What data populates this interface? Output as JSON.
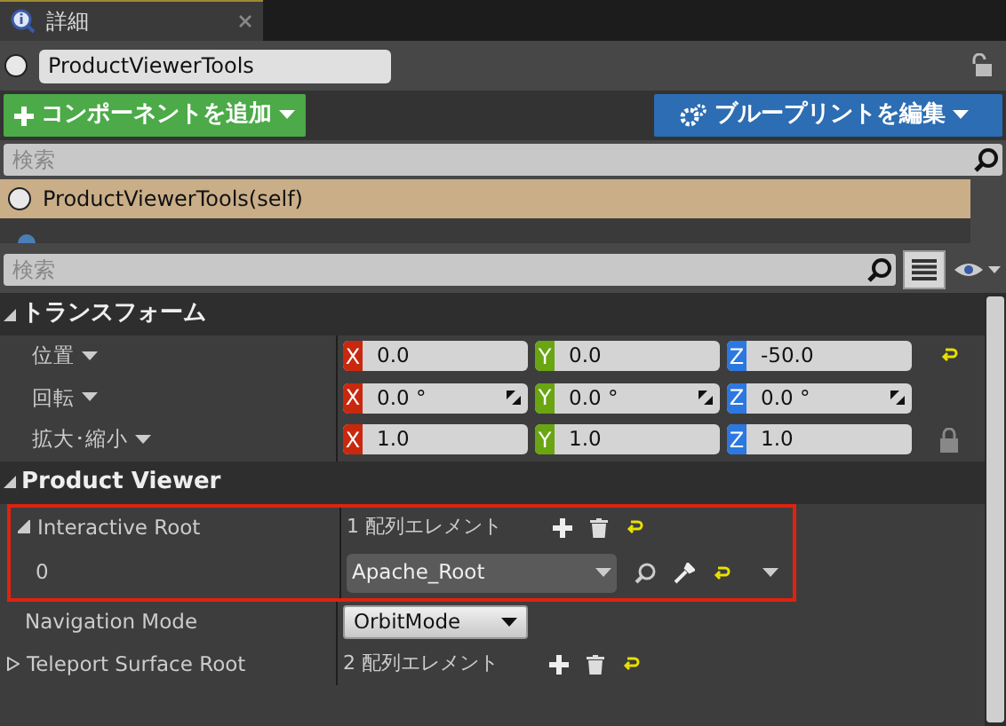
{
  "tab": {
    "title": "詳細"
  },
  "actor_name": "ProductViewerTools",
  "add_button": "コンポーネントを追加",
  "edit_button": "ブループリントを編集",
  "component_search": {
    "placeholder": "検索"
  },
  "components": [
    {
      "label": "ProductViewerTools(self)",
      "selected": true
    }
  ],
  "details_search": {
    "placeholder": "検索"
  },
  "sections": [
    {
      "title": "トランスフォーム",
      "expanded": true,
      "rows": [
        {
          "kind": "vector",
          "label": "位置",
          "reset": true,
          "locked": false,
          "spin": false,
          "fields": [
            {
              "axis": "X",
              "value": "0.0"
            },
            {
              "axis": "Y",
              "value": "0.0"
            },
            {
              "axis": "Z",
              "value": "-50.0"
            }
          ]
        },
        {
          "kind": "vector",
          "label": "回転",
          "reset": false,
          "locked": false,
          "spin": true,
          "fields": [
            {
              "axis": "X",
              "value": "0.0 °"
            },
            {
              "axis": "Y",
              "value": "0.0 °"
            },
            {
              "axis": "Z",
              "value": "0.0 °"
            }
          ]
        },
        {
          "kind": "vector",
          "label": "拡大･縮小",
          "reset": false,
          "locked": true,
          "spin": false,
          "fields": [
            {
              "axis": "X",
              "value": "1.0"
            },
            {
              "axis": "Y",
              "value": "1.0"
            },
            {
              "axis": "Z",
              "value": "1.0"
            }
          ]
        }
      ]
    },
    {
      "title": "Product Viewer",
      "expanded": true,
      "rows": [
        {
          "kind": "array",
          "label": "Interactive Root",
          "expanded": true,
          "count": "1 配列エレメント",
          "highlighted": true
        },
        {
          "kind": "asset",
          "label": "0",
          "value": "Apache_Root",
          "highlighted": true
        },
        {
          "kind": "enum",
          "label": "Navigation Mode",
          "value": "OrbitMode",
          "highlighted": false
        },
        {
          "kind": "array",
          "label": "Teleport Surface Root",
          "expanded": false,
          "count": "2 配列エレメント",
          "highlighted": false
        }
      ]
    }
  ]
}
